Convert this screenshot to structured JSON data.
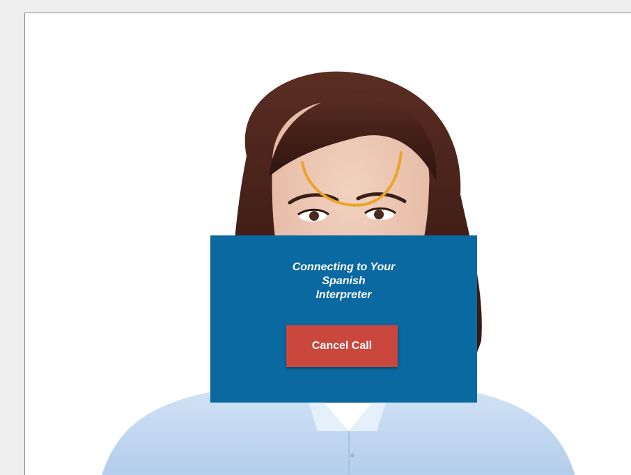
{
  "call": {
    "status_lines": [
      "Connecting to Your",
      "Spanish",
      "Interpreter"
    ],
    "cancel_label": "Cancel Call"
  },
  "colors": {
    "background": "#efefef",
    "overlay_panel": "#0a69a1",
    "cancel_button": "#c9473c",
    "spinner": "#e8a52a"
  },
  "icons": {
    "spinner": "loading-spinner-icon"
  }
}
